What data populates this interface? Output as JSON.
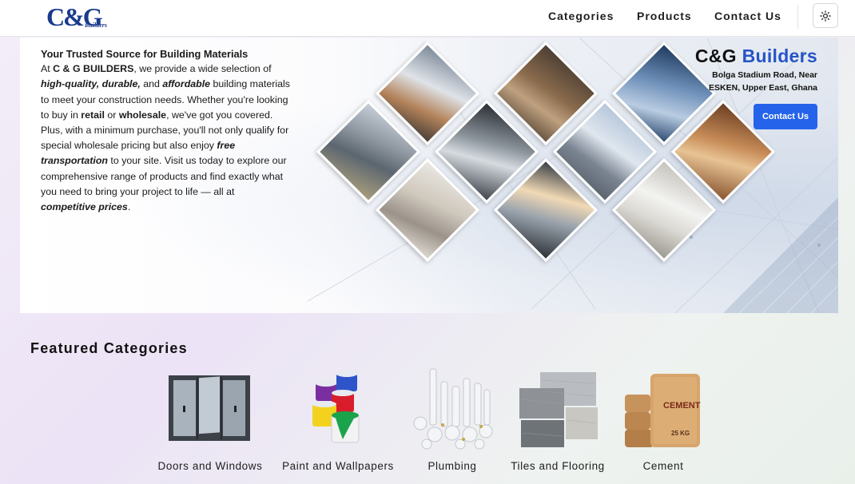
{
  "nav": {
    "logo_main": "C&G",
    "logo_sub": "Builders",
    "links": [
      "Categories",
      "Products",
      "Contact Us"
    ]
  },
  "hero": {
    "heading": "Your Trusted Source for Building Materials",
    "p1": "At ",
    "p2": "C & G BUILDERS",
    "p3": ", we provide a wide selection of ",
    "p4": "high-quality, durable,",
    "p5": " and ",
    "p6": "affordable",
    "p7": " building materials to meet your construction needs. Whether you're looking to buy in ",
    "p8": "retail",
    "p9": " or ",
    "p10": "wholesale",
    "p11": ", we've got you covered. Plus, with a minimum purchase, you'll not only qualify for special wholesale pricing but also enjoy ",
    "p12": "free transportation",
    "p13": " to your site. Visit us today to explore our comprehensive range of products and find exactly what you need to bring your project to life — all at ",
    "p14": "competitive prices",
    "p15": ".",
    "brand_cg": "C&G",
    "brand_builders": "Builders",
    "address_line1": "Bolga Stadium Road, Near",
    "address_line2": "ESKEN, Upper East, Ghana",
    "contact_label": "Contact Us"
  },
  "featured": {
    "title": "Featured Categories",
    "categories": [
      {
        "label": "Doors and Windows",
        "icon": "doors-windows-image"
      },
      {
        "label": "Paint and Wallpapers",
        "icon": "paint-cans-image"
      },
      {
        "label": "Plumbing",
        "icon": "pipes-fittings-image"
      },
      {
        "label": "Tiles and Flooring",
        "icon": "tiles-image"
      },
      {
        "label": "Cement",
        "icon": "cement-bags-image"
      }
    ],
    "cement_bag_text": "CEMENT",
    "cement_bag_weight": "25 KG"
  },
  "colors": {
    "brand_blue": "#2554c7",
    "button_blue": "#2563eb",
    "logo_blue": "#1a3a8c"
  }
}
